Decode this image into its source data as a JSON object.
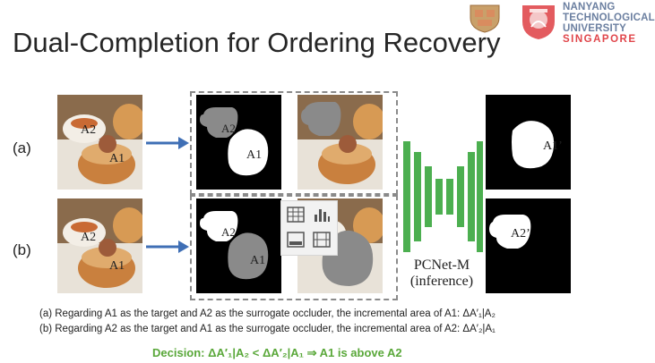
{
  "slide": {
    "title": "Dual-Completion for Ordering Recovery",
    "logos": {
      "ntu_line1": "NANYANG",
      "ntu_line2": "TECHNOLOGICAL",
      "ntu_line3": "UNIVERSITY",
      "ntu_line4": "SINGAPORE"
    },
    "rows": [
      {
        "label": "(a)",
        "label_a2": "A2",
        "label_a1": "A1",
        "result": "A1’"
      },
      {
        "label": "(b)",
        "label_a2": "A2",
        "label_a1": "A1",
        "result": "A2’"
      }
    ],
    "network": {
      "name": "PCNet-M",
      "mode": "(inference)"
    },
    "captions": [
      "(a) Regarding A1 as the target and A2 as the surrogate occluder, the incremental area of A1: ΔA′₁|A₂",
      "(b) Regarding A2 as the target and A1 as the surrogate occluder, the incremental area of A2: ΔA′₂|A₁"
    ],
    "decision": "Decision: ΔA′₁|A₂ < ΔA′₂|A₁ ⇒ A1 is above A2",
    "colors": {
      "network": "#4caf50",
      "arrow": "#3f6fb5",
      "decision": "#5aa83a",
      "gray_mask": "#808080"
    },
    "toolbar_icons": [
      "table-icon",
      "chart-icon",
      "image-icon",
      "film-icon"
    ]
  }
}
